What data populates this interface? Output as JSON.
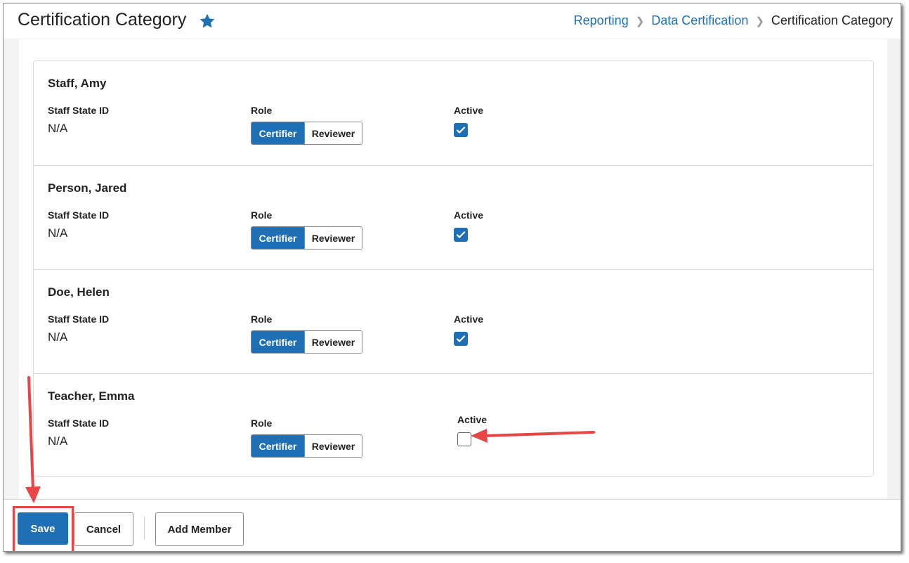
{
  "header": {
    "title": "Certification Category",
    "breadcrumb": [
      "Reporting",
      "Data Certification",
      "Certification Category"
    ]
  },
  "labels": {
    "staff_state_id": "Staff State ID",
    "role": "Role",
    "active": "Active",
    "certifier": "Certifier",
    "reviewer": "Reviewer"
  },
  "members": [
    {
      "name": "Staff, Amy",
      "staff_state_id": "N/A",
      "role_selected": "Certifier",
      "active": true
    },
    {
      "name": "Person, Jared",
      "staff_state_id": "N/A",
      "role_selected": "Certifier",
      "active": true
    },
    {
      "name": "Doe, Helen",
      "staff_state_id": "N/A",
      "role_selected": "Certifier",
      "active": true
    },
    {
      "name": "Teacher, Emma",
      "staff_state_id": "N/A",
      "role_selected": "Certifier",
      "active": false
    }
  ],
  "footer": {
    "save_label": "Save",
    "cancel_label": "Cancel",
    "add_member_label": "Add Member"
  },
  "colors": {
    "accent": "#1f6fb5",
    "link": "#1a6fb5",
    "annotation": "#e84646"
  }
}
